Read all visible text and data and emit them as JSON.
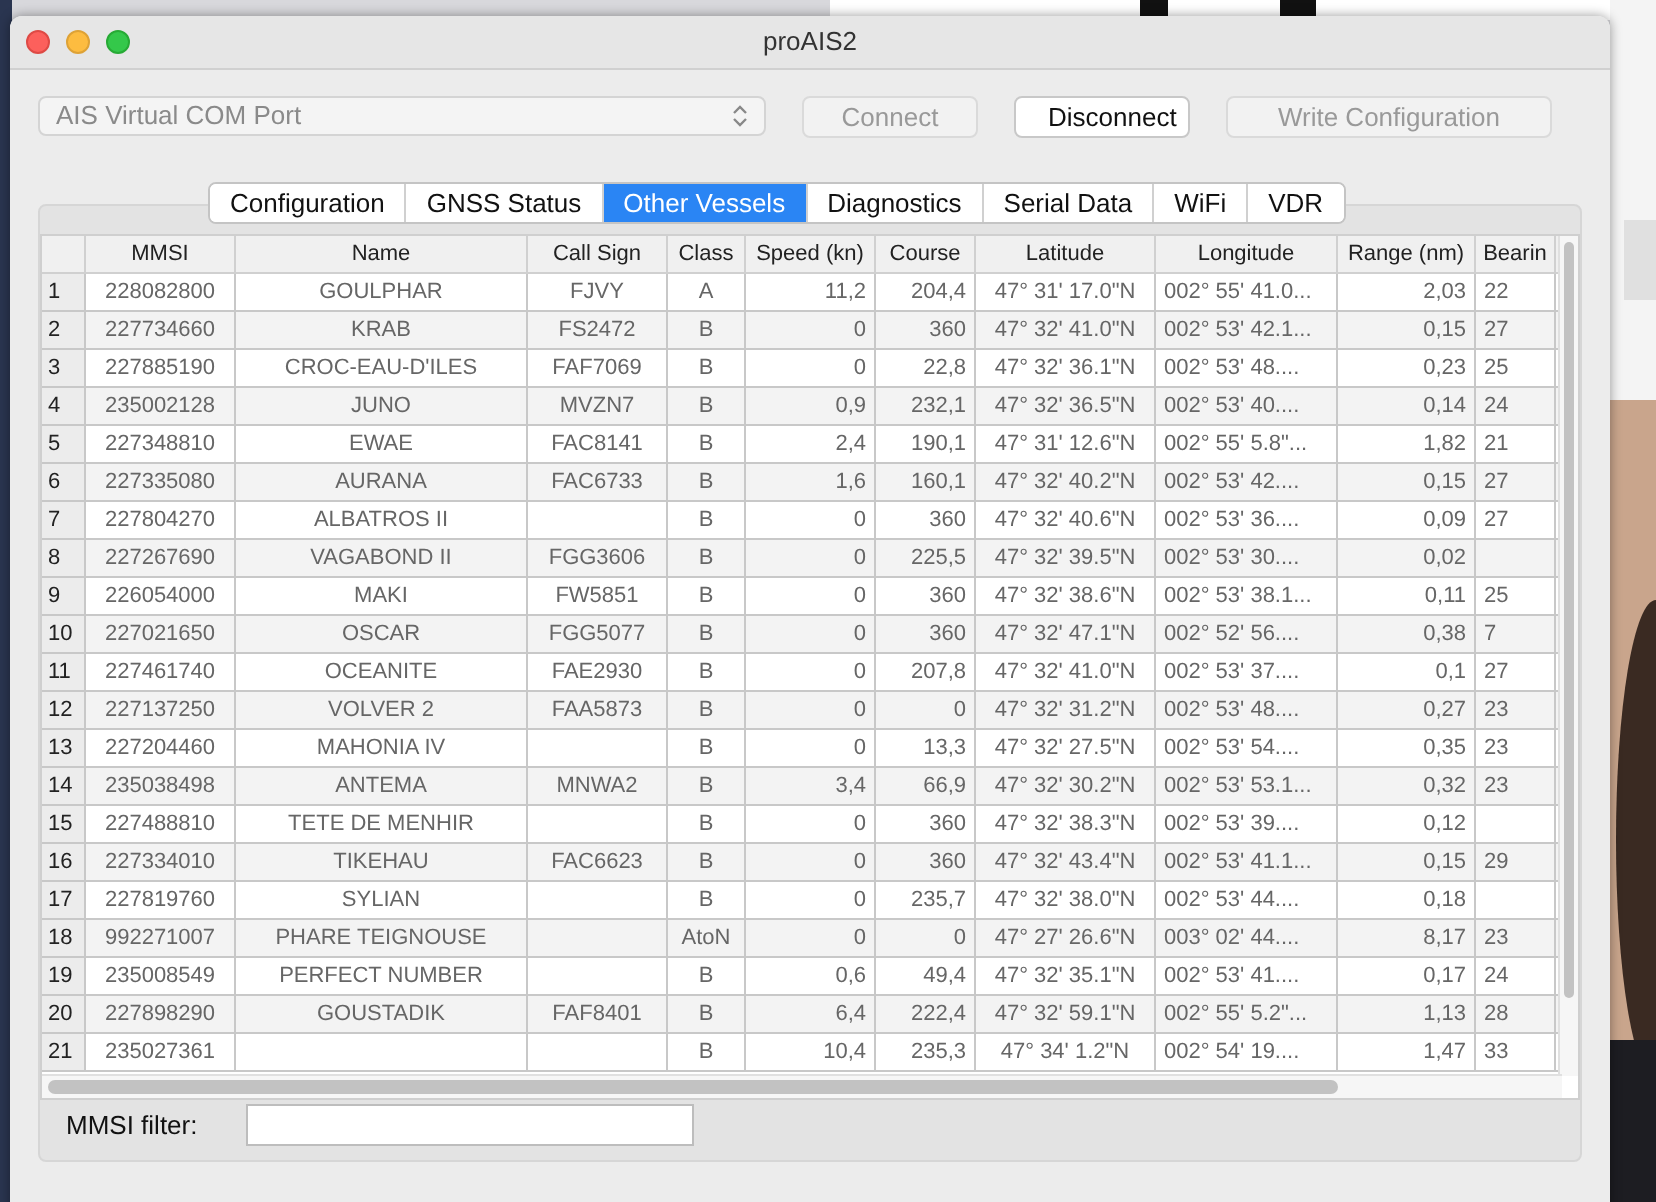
{
  "window": {
    "title": "proAIS2"
  },
  "port_select": {
    "value": "AIS Virtual COM Port",
    "disabled": true
  },
  "buttons": [
    {
      "label": "Connect",
      "disabled": true
    },
    {
      "label": "Disconnect",
      "disabled": false
    },
    {
      "label": "Write Configuration",
      "disabled": true
    }
  ],
  "tabs": [
    {
      "label": "Configuration",
      "selected": false
    },
    {
      "label": "GNSS Status",
      "selected": false
    },
    {
      "label": "Other Vessels",
      "selected": true
    },
    {
      "label": "Diagnostics",
      "selected": false
    },
    {
      "label": "Serial Data",
      "selected": false
    },
    {
      "label": "WiFi",
      "selected": false
    },
    {
      "label": "VDR",
      "selected": false
    }
  ],
  "table": {
    "columns": [
      "MMSI",
      "Name",
      "Call Sign",
      "Class",
      "Speed (kn)",
      "Course",
      "Latitude",
      "Longitude",
      "Range (nm)",
      "Bearin"
    ],
    "rows": [
      {
        "num": "1",
        "mmsi": "228082800",
        "name": "GOULPHAR",
        "call_sign": "FJVY",
        "class": "A",
        "speed": "11,2",
        "course": "204,4",
        "latitude": "47° 31' 17.0\"N",
        "longitude": "002° 55' 41.0...",
        "range": "2,03",
        "bearing": "22"
      },
      {
        "num": "2",
        "mmsi": "227734660",
        "name": "KRAB",
        "call_sign": "FS2472",
        "class": "B",
        "speed": "0",
        "course": "360",
        "latitude": "47° 32' 41.0\"N",
        "longitude": "002° 53' 42.1...",
        "range": "0,15",
        "bearing": "27"
      },
      {
        "num": "3",
        "mmsi": "227885190",
        "name": "CROC-EAU-D'ILES",
        "call_sign": "FAF7069",
        "class": "B",
        "speed": "0",
        "course": "22,8",
        "latitude": "47° 32' 36.1\"N",
        "longitude": "002° 53' 48....",
        "range": "0,23",
        "bearing": "25"
      },
      {
        "num": "4",
        "mmsi": "235002128",
        "name": "JUNO",
        "call_sign": "MVZN7",
        "class": "B",
        "speed": "0,9",
        "course": "232,1",
        "latitude": "47° 32' 36.5\"N",
        "longitude": "002° 53' 40....",
        "range": "0,14",
        "bearing": "24"
      },
      {
        "num": "5",
        "mmsi": "227348810",
        "name": "EWAE",
        "call_sign": "FAC8141",
        "class": "B",
        "speed": "2,4",
        "course": "190,1",
        "latitude": "47° 31' 12.6\"N",
        "longitude": "002° 55' 5.8\"...",
        "range": "1,82",
        "bearing": "21"
      },
      {
        "num": "6",
        "mmsi": "227335080",
        "name": "AURANA",
        "call_sign": "FAC6733",
        "class": "B",
        "speed": "1,6",
        "course": "160,1",
        "latitude": "47° 32' 40.2\"N",
        "longitude": "002° 53' 42....",
        "range": "0,15",
        "bearing": "27"
      },
      {
        "num": "7",
        "mmsi": "227804270",
        "name": "ALBATROS II",
        "class": "B",
        "speed": "0",
        "course": "360",
        "latitude": "47° 32' 40.6\"N",
        "longitude": "002° 53' 36....",
        "range": "0,09",
        "bearing": "27"
      },
      {
        "num": "8",
        "mmsi": "227267690",
        "name": "VAGABOND II",
        "call_sign": "FGG3606",
        "class": "B",
        "speed": "0",
        "course": "225,5",
        "latitude": "47° 32' 39.5\"N",
        "longitude": "002° 53' 30....",
        "range": "0,02"
      },
      {
        "num": "9",
        "mmsi": "226054000",
        "name": "MAKI",
        "call_sign": "FW5851",
        "class": "B",
        "speed": "0",
        "course": "360",
        "latitude": "47° 32' 38.6\"N",
        "longitude": "002° 53' 38.1...",
        "range": "0,11",
        "bearing": "25"
      },
      {
        "num": "10",
        "mmsi": "227021650",
        "name": "OSCAR",
        "call_sign": "FGG5077",
        "class": "B",
        "speed": "0",
        "course": "360",
        "latitude": "47° 32' 47.1\"N",
        "longitude": "002° 52' 56....",
        "range": "0,38",
        "bearing": "7"
      },
      {
        "num": "11",
        "mmsi": "227461740",
        "name": "OCEANITE",
        "call_sign": "FAE2930",
        "class": "B",
        "speed": "0",
        "course": "207,8",
        "latitude": "47° 32' 41.0\"N",
        "longitude": "002° 53' 37....",
        "range": "0,1",
        "bearing": "27"
      },
      {
        "num": "12",
        "mmsi": "227137250",
        "name": "VOLVER 2",
        "call_sign": "FAA5873",
        "class": "B",
        "speed": "0",
        "course": "0",
        "latitude": "47° 32' 31.2\"N",
        "longitude": "002° 53' 48....",
        "range": "0,27",
        "bearing": "23"
      },
      {
        "num": "13",
        "mmsi": "227204460",
        "name": "MAHONIA IV",
        "class": "B",
        "speed": "0",
        "course": "13,3",
        "latitude": "47° 32' 27.5\"N",
        "longitude": "002° 53' 54....",
        "range": "0,35",
        "bearing": "23"
      },
      {
        "num": "14",
        "mmsi": "235038498",
        "name": "ANTEMA",
        "call_sign": "MNWA2",
        "class": "B",
        "speed": "3,4",
        "course": "66,9",
        "latitude": "47° 32' 30.2\"N",
        "longitude": "002° 53' 53.1...",
        "range": "0,32",
        "bearing": "23"
      },
      {
        "num": "15",
        "mmsi": "227488810",
        "name": "TETE DE MENHIR",
        "class": "B",
        "speed": "0",
        "course": "360",
        "latitude": "47° 32' 38.3\"N",
        "longitude": "002° 53' 39....",
        "range": "0,12"
      },
      {
        "num": "16",
        "mmsi": "227334010",
        "name": "TIKEHAU",
        "call_sign": "FAC6623",
        "class": "B",
        "speed": "0",
        "course": "360",
        "latitude": "47° 32' 43.4\"N",
        "longitude": "002° 53' 41.1...",
        "range": "0,15",
        "bearing": "29"
      },
      {
        "num": "17",
        "mmsi": "227819760",
        "name": "SYLIAN",
        "class": "B",
        "speed": "0",
        "course": "235,7",
        "latitude": "47° 32' 38.0\"N",
        "longitude": "002° 53' 44....",
        "range": "0,18"
      },
      {
        "num": "18",
        "mmsi": "992271007",
        "name": "PHARE TEIGNOUSE",
        "class": "AtoN",
        "speed": "0",
        "course": "0",
        "latitude": "47° 27' 26.6\"N",
        "longitude": "003° 02' 44....",
        "range": "8,17",
        "bearing": "23"
      },
      {
        "num": "19",
        "mmsi": "235008549",
        "name": "PERFECT NUMBER",
        "class": "B",
        "speed": "0,6",
        "course": "49,4",
        "latitude": "47° 32' 35.1\"N",
        "longitude": "002° 53' 41....",
        "range": "0,17",
        "bearing": "24"
      },
      {
        "num": "20",
        "mmsi": "227898290",
        "name": "GOUSTADIK",
        "call_sign": "FAF8401",
        "class": "B",
        "speed": "6,4",
        "course": "222,4",
        "latitude": "47° 32' 59.1\"N",
        "longitude": "002° 55' 5.2\"...",
        "range": "1,13",
        "bearing": "28"
      },
      {
        "num": "21",
        "mmsi": "235027361",
        "class": "B",
        "speed": "10,4",
        "course": "235,3",
        "latitude": "47° 34' 1.2\"N",
        "longitude": "002° 54' 19....",
        "range": "1,47",
        "bearing": "33"
      }
    ]
  },
  "filter": {
    "label": "MMSI filter:"
  }
}
